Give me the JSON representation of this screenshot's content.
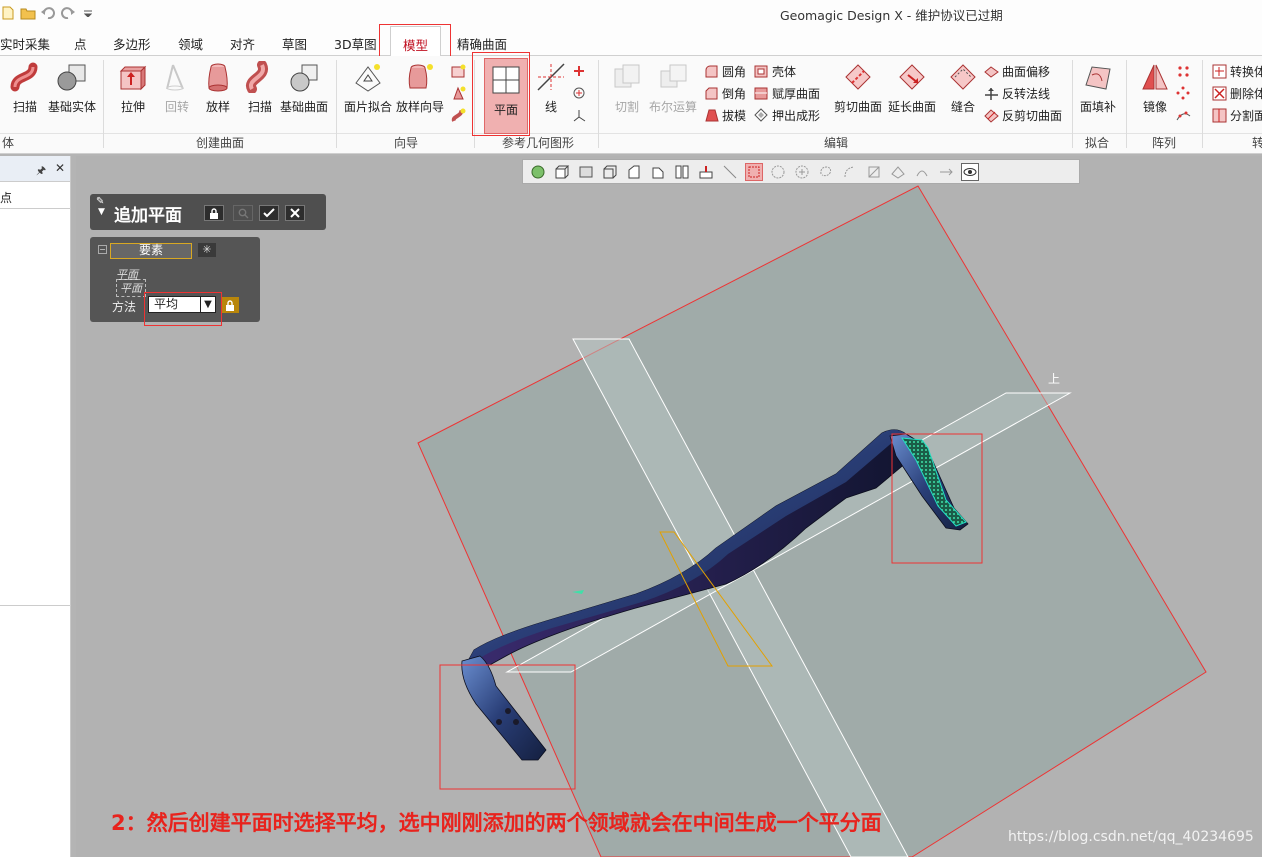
{
  "window": {
    "title": "Geomagic Design X - 维护协议已过期"
  },
  "ribbon_tabs": [
    "实时采集",
    "点",
    "多边形",
    "领域",
    "对齐",
    "草图",
    "3D草图",
    "模型",
    "精确曲面"
  ],
  "active_tab": "模型",
  "groups": {
    "solid": {
      "label": "体",
      "buttons": [
        "扫描",
        "基础实体"
      ]
    },
    "create_surface": {
      "label": "创建曲面",
      "buttons": [
        "拉伸",
        "回转",
        "放样",
        "扫描",
        "基础曲面"
      ]
    },
    "wizard": {
      "label": "向导",
      "buttons": [
        "面片拟合",
        "放样向导"
      ]
    },
    "ref_geometry": {
      "label": "参考几何图形",
      "buttons": [
        "平面",
        "线"
      ]
    },
    "edit": {
      "label": "编辑",
      "buttons": [
        "切割",
        "布尔运算",
        "剪切曲面",
        "延长曲面",
        "缝合"
      ],
      "small": [
        "圆角",
        "壳体",
        "倒角",
        "赋厚曲面",
        "拔模",
        "押出成形",
        "曲面偏移",
        "反转法线",
        "反剪切曲面"
      ]
    },
    "fit": {
      "label": "拟合",
      "buttons": [
        "面填补"
      ]
    },
    "pattern": {
      "label": "阵列",
      "buttons": [
        "镜像"
      ]
    },
    "convert": {
      "label": "转",
      "small": [
        "转换体",
        "删除体",
        "分割面"
      ]
    }
  },
  "left_panel": {
    "row": "点"
  },
  "dialog": {
    "title": "追加平面",
    "section": "要素",
    "items": [
      "平面",
      "平面"
    ],
    "method_label": "方法",
    "method_value": "平均"
  },
  "viewport": {
    "up_label": "上"
  },
  "caption": "2：然后创建平面时选择平均，选中刚刚添加的两个领域就会在中间生成一个平分面",
  "watermark": "https://blog.csdn.net/qq_40234695",
  "colors": {
    "highlight": "#e33333",
    "caption": "#e8231d",
    "accent_tab": "#c01020"
  }
}
